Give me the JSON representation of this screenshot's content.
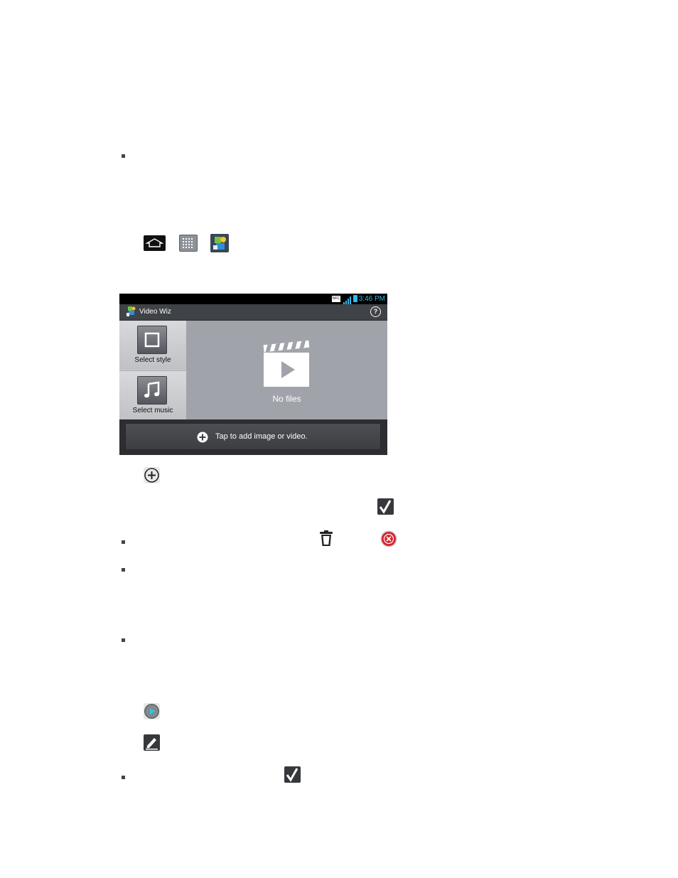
{
  "phone": {
    "status_time": "3:46 PM",
    "status_nfc": "NFC",
    "app_title": "Video Wiz",
    "help_label": "?",
    "select_style_label": "Select style",
    "select_music_label": "Select music",
    "no_files_label": "No files",
    "add_bar_label": "Tap to add image or video."
  },
  "icons": {
    "home": "home-key-icon",
    "apps": "applications-grid-icon",
    "video_wiz": "video-wiz-app-icon",
    "add": "plus-circle-icon",
    "check": "checkmark-icon",
    "trash": "trash-icon",
    "close": "red-x-circle-icon",
    "play": "play-circle-icon",
    "edit": "pencil-edit-icon"
  },
  "colors": {
    "status_time": "#35b8e8",
    "close_icon": "#d9232e",
    "play_icon": "#27c7e3"
  }
}
